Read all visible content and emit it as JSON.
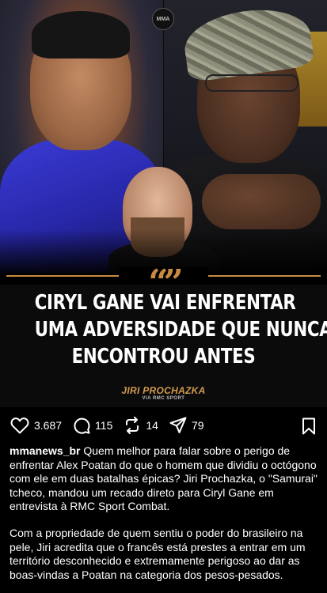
{
  "post": {
    "headline_lines": [
      "CIRYL GANE VAI ENFRENTAR",
      "UMA ADVERSIDADE QUE NUNCA",
      "ENCONTROU ANTES"
    ],
    "quote_source": "JIRI PROCHAZKA",
    "quote_via": "VIA RMC SPORT",
    "quote_mark": "“”"
  },
  "actions": {
    "likes": "3.687",
    "comments": "115",
    "reposts": "14",
    "shares": "79"
  },
  "caption": {
    "username": "mmanews_br",
    "paragraph1": " Quem melhor para falar sobre o perigo de enfrentar Alex Poatan do que o homem que dividiu o octógono com ele em duas batalhas épicas? Jiri Prochazka, o \"Samurai\" tcheco, mandou um recado direto para Ciryl Gane em entrevista à RMC Sport Combat.",
    "paragraph2": "Com a propriedade de quem sentiu o poder do brasileiro na pele, Jiri acredita que o francês está prestes a entrar em um território desconhecido e extremamente perigoso ao dar as boas-vindas a Poatan na categoria dos pesos-pesados."
  },
  "colors": {
    "accent": "#c88a42",
    "background": "#000000",
    "text": "#ffffff"
  },
  "icons": [
    "heart-icon",
    "comment-icon",
    "repost-icon",
    "share-icon",
    "bookmark-icon"
  ]
}
